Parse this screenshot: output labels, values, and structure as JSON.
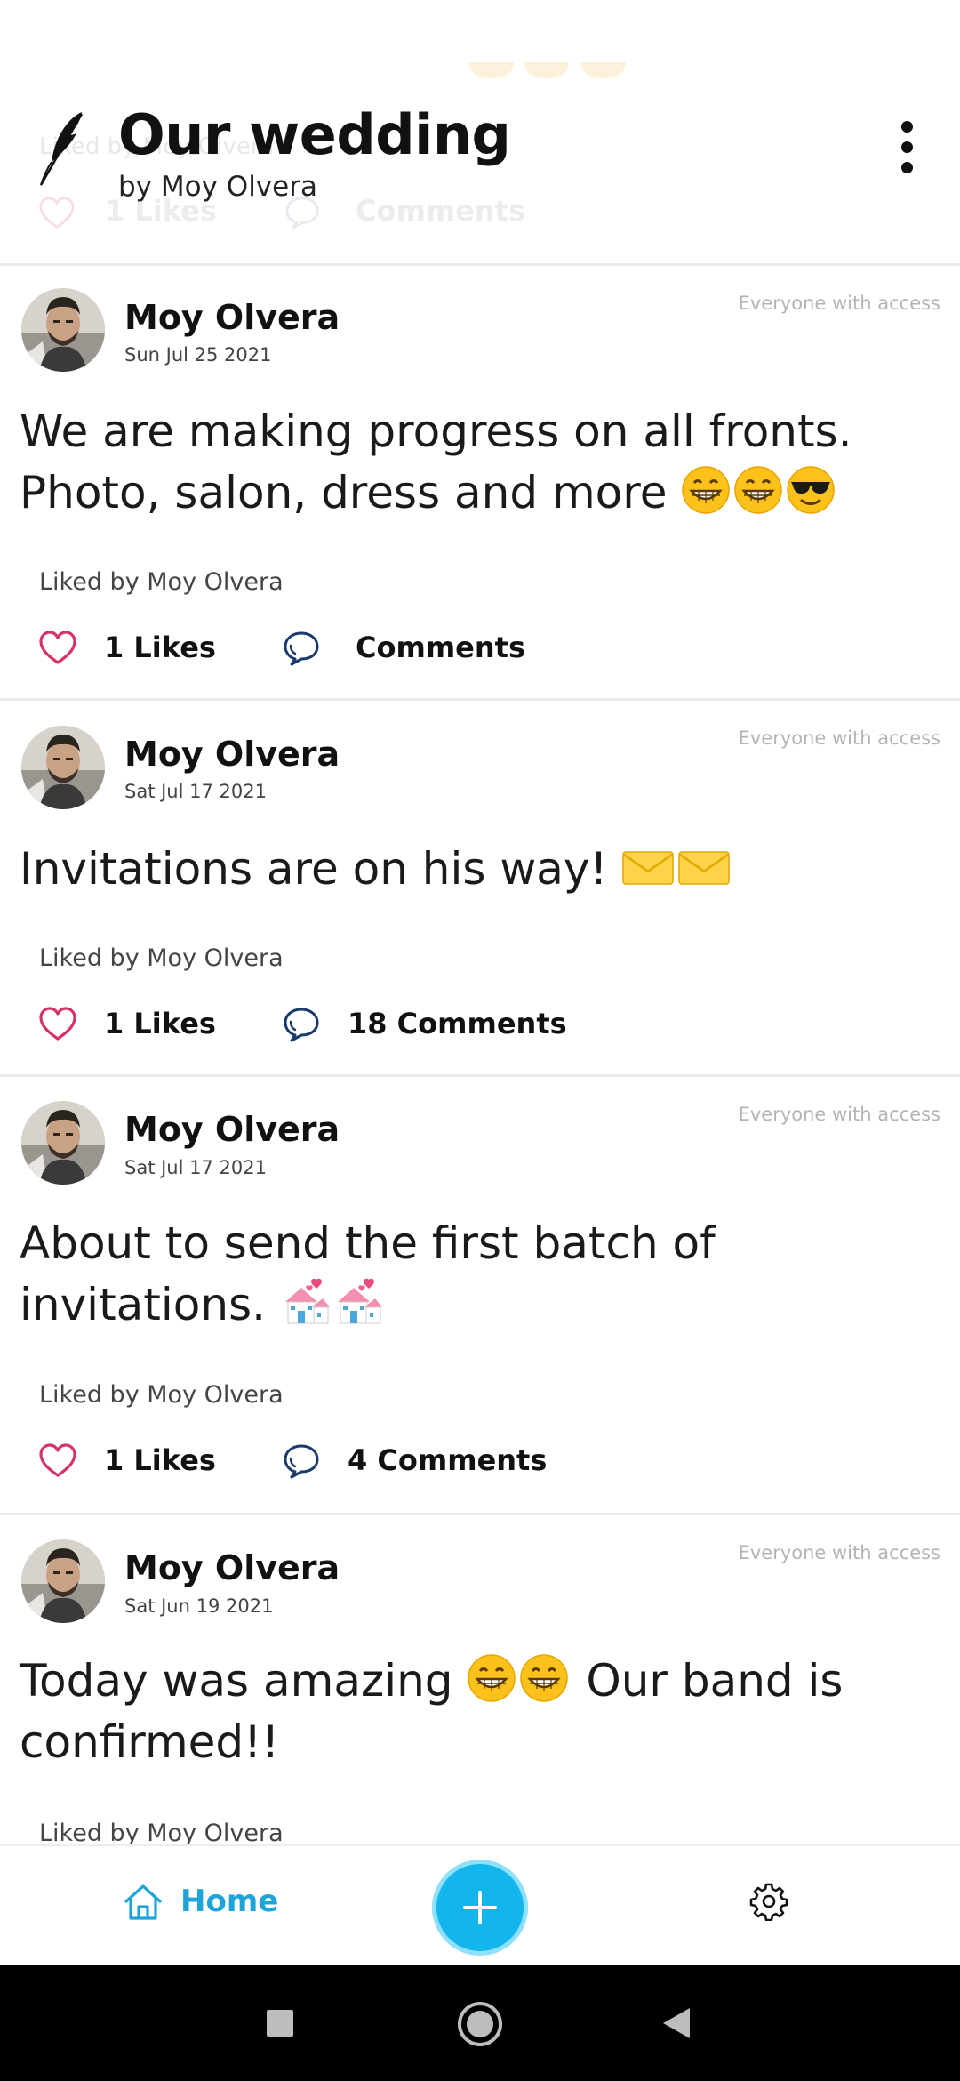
{
  "header": {
    "title": "Our wedding",
    "byline": "by Moy Olvera",
    "behind": {
      "liked_by": "Liked by Moy Olvera",
      "likes": "1 Likes",
      "comments": "Comments"
    }
  },
  "posts": [
    {
      "author": "Moy Olvera",
      "date": "Sun Jul 25 2021",
      "visibility": "Everyone with access",
      "text": "We are making progress on all fronts. Photo, salon, dress and more",
      "emojis": [
        "grin",
        "grin",
        "sunglasses"
      ],
      "liked_by": "Liked by Moy Olvera",
      "likes": "1 Likes",
      "comments": "Comments"
    },
    {
      "author": "Moy Olvera",
      "date": "Sat Jul 17 2021",
      "visibility": "Everyone with access",
      "text": "Invitations are on his way!",
      "emojis": [
        "envelope",
        "envelope"
      ],
      "liked_by": "Liked by Moy Olvera",
      "likes": "1 Likes",
      "comments": "18 Comments"
    },
    {
      "author": "Moy Olvera",
      "date": "Sat Jul 17 2021",
      "visibility": "Everyone with access",
      "text": "About to send the first batch of invitations.",
      "emojis": [
        "wedding-chapel",
        "wedding-chapel"
      ],
      "liked_by": "Liked by Moy Olvera",
      "likes": "1 Likes",
      "comments": "4 Comments"
    },
    {
      "author": "Moy Olvera",
      "date": "Sat Jun 19 2021",
      "visibility": "Everyone with access",
      "text_before": "Today was amazing",
      "text_after": "Our band is confirmed!!",
      "emojis": [
        "grin",
        "grin"
      ],
      "liked_by": "Liked by Moy Olvera"
    }
  ],
  "bottom_nav": {
    "home_label": "Home",
    "add_icon": "plus-icon",
    "settings_icon": "gear-icon"
  },
  "colors": {
    "accent": "#13b6ec",
    "heart": "#d6336c",
    "comment_icon": "#1a3a6b"
  }
}
